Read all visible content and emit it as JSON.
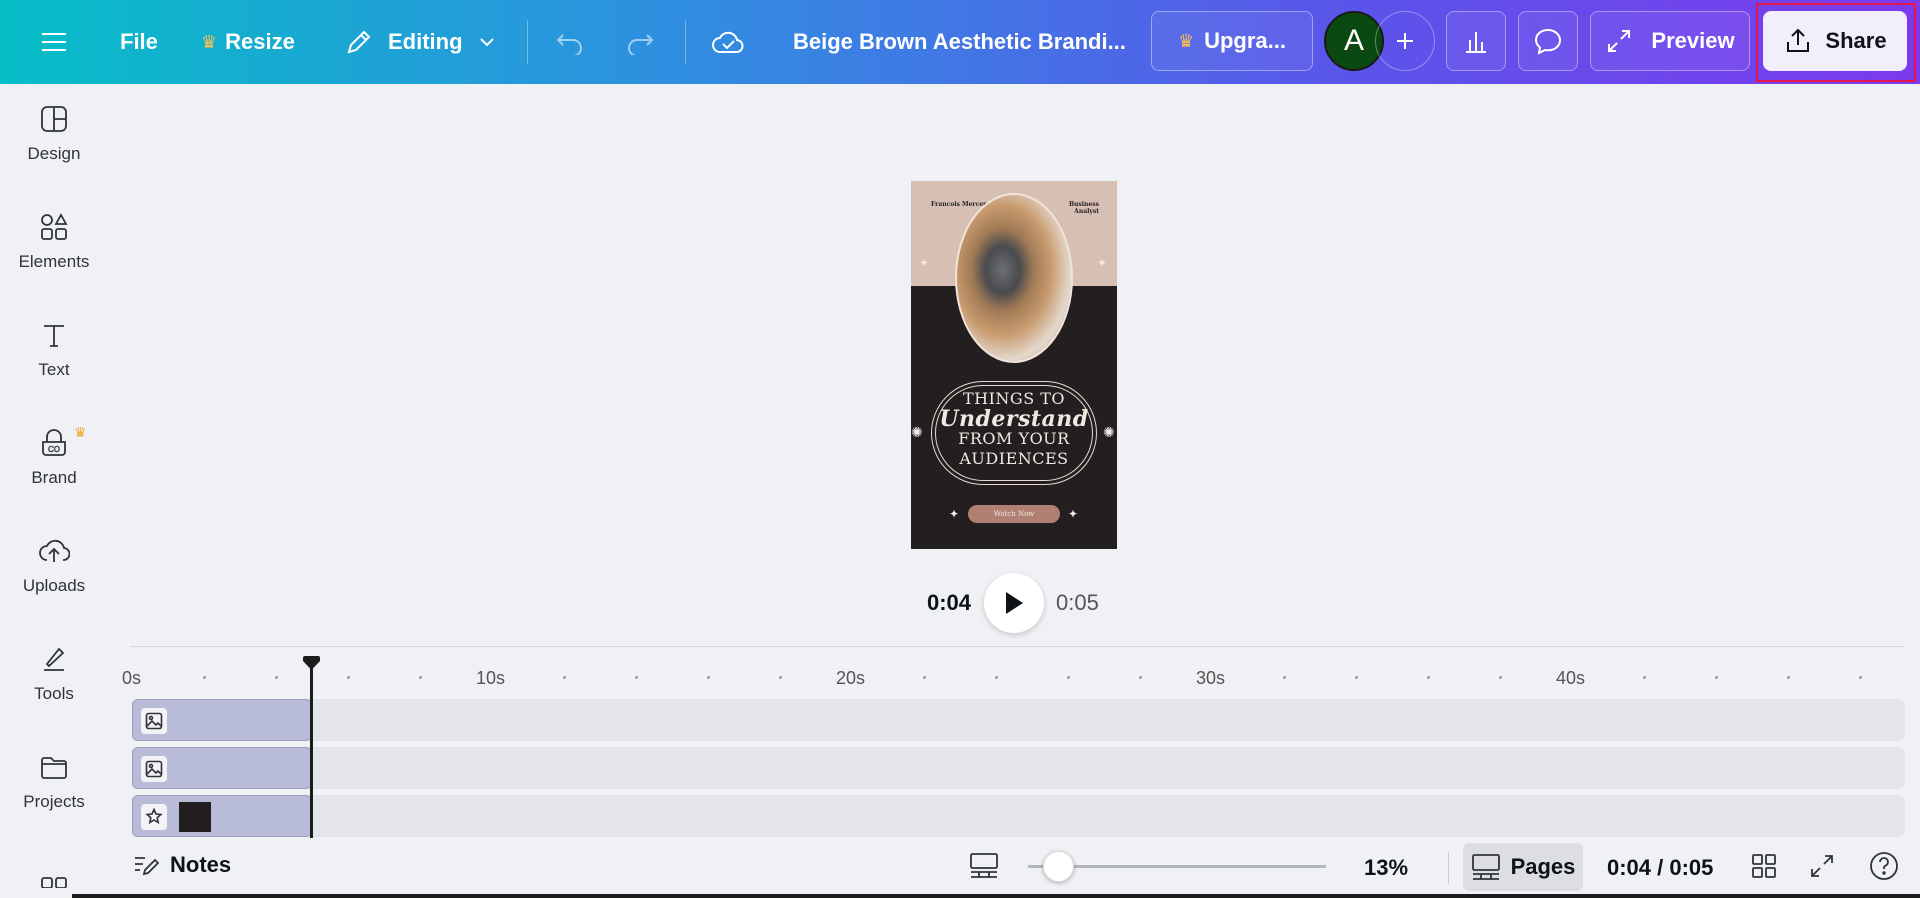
{
  "topbar": {
    "file": "File",
    "resize": "Resize",
    "editing": "Editing",
    "title": "Beige Brown Aesthetic Brandi...",
    "upgrade": "Upgra...",
    "avatar_initial": "A",
    "preview": "Preview",
    "share": "Share"
  },
  "sidebar": {
    "items": [
      {
        "label": "Design",
        "icon": "design-icon"
      },
      {
        "label": "Elements",
        "icon": "elements-icon"
      },
      {
        "label": "Text",
        "icon": "text-icon"
      },
      {
        "label": "Brand",
        "icon": "brand-icon"
      },
      {
        "label": "Uploads",
        "icon": "uploads-icon"
      },
      {
        "label": "Tools",
        "icon": "tools-icon"
      },
      {
        "label": "Projects",
        "icon": "projects-icon"
      }
    ]
  },
  "design": {
    "name_left": "Francois Mercer",
    "role_right": "Business Analyst",
    "line1": "THINGS TO",
    "line2": "Understand",
    "line3": "FROM YOUR",
    "line4": "AUDIENCES",
    "button": "Watch Now"
  },
  "playback": {
    "current": "0:04",
    "total": "0:05"
  },
  "timeline": {
    "labels": [
      "0s",
      "10s",
      "20s",
      "30s",
      "40s"
    ]
  },
  "bottombar": {
    "notes": "Notes",
    "zoom": "13%",
    "pages": "Pages",
    "time": "0:04 / 0:05"
  },
  "colors": {
    "accent": "#7c3aed",
    "highlight": "#e2174e",
    "design_dark": "#231f20",
    "design_beige": "#d8bfb3"
  }
}
